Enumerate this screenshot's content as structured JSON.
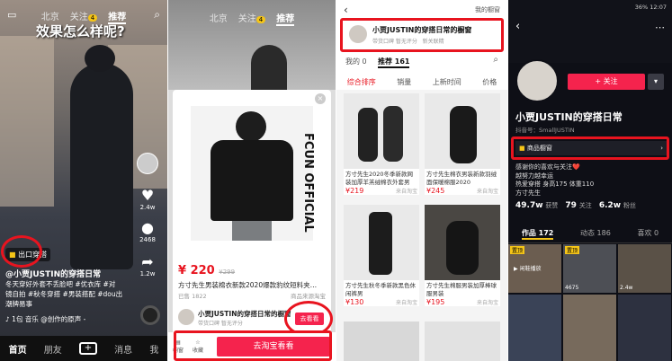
{
  "p1": {
    "nav": [
      "北京",
      "关注",
      "推荐"
    ],
    "nav_badge": "4",
    "overlay_caption": "效果怎么样呢?",
    "side_counts": {
      "like": "2.4w",
      "comment": "2468",
      "share": "1.2w"
    },
    "store_tag": "出口穿搭",
    "author": "@小贾JUSTIN的穿搭日常",
    "desc_line1": "冬天穿好外套不丢脸吧 #优衣库 #对",
    "desc_line2": "镜自拍 #秋冬穿搭 #男装搭配 #dou出",
    "desc_line3": "潮牌易事",
    "music": "♪ 1包 音乐 @创作的原声 - ",
    "bottom_nav": [
      "首页",
      "朋友",
      "+",
      "消息",
      "我"
    ]
  },
  "p2": {
    "nav": [
      "北京",
      "关注",
      "推荐"
    ],
    "nav_badge": "4",
    "price": "¥ 220",
    "orig_price": "¥299",
    "title": "方寸先生男装棉衣新款2020爆款豹纹短料夹…",
    "sold": "已售 1822",
    "source": "商品来源淘宝",
    "shop_name": "小贾JUSTIN的穿搭日常的橱窗",
    "shop_sub": "带货口碑  暂无评分",
    "goto_btn": "去看看",
    "bar_icons": [
      "橱窗",
      "收藏"
    ],
    "bar_btn": "去淘宝看看",
    "brand_text": "FCUN OFFICIAL"
  },
  "p3": {
    "header_right": "我的橱窗",
    "shop_name": "小贾JUSTIN的穿搭日常的橱窗",
    "shop_sub1": "带货口碑  暂无评分",
    "shop_sub2": "新关联精",
    "tab_mine": "我的 0",
    "tab_rec": "推荐 161",
    "sort_tabs": [
      "综合排序",
      "销量",
      "上新时间",
      "价格"
    ],
    "products": [
      {
        "title": "方寸先生2020冬季新款网装加厚羊羔绒棉衣外套男",
        "price": "¥219",
        "src": "来自淘宝"
      },
      {
        "title": "方寸先生棉衣男装新款羽绒面保暖棉服2020",
        "price": "¥245",
        "src": "来自淘宝"
      },
      {
        "title": "方寸先生秋冬季新款黑色休闲裤男",
        "price": "¥130",
        "src": "来自淘宝"
      },
      {
        "title": "方寸先生棉服男装加厚棒球服男装",
        "price": "¥195",
        "src": "来自淘宝"
      }
    ]
  },
  "p4": {
    "status_right": "36%  12:07",
    "follow_btn": "+ 关注",
    "name": "小贾JUSTIN的穿搭日常",
    "douyin_id": "抖音号：SmallJUSTIN",
    "window_label": "商品橱窗",
    "bio1": "感谢你的喜欢与关注❤️",
    "bio2": "越努力越幸运",
    "bio3": "热爱穿搭 身高175 体重110",
    "bio4": "方寸先生",
    "stats": [
      {
        "n": "49.7w",
        "l": "获赞"
      },
      {
        "n": "79",
        "l": "关注"
      },
      {
        "n": "6.2w",
        "l": "粉丝"
      }
    ],
    "tabs": [
      "作品 172",
      "动态 186",
      "喜欢 0"
    ],
    "cell_tags": [
      "置顶",
      "置顶"
    ],
    "cell_play": "▶ 闲鞋播放",
    "cell_counts": [
      "4675",
      "2.4w"
    ]
  },
  "colors": {
    "accent": "#e8141f",
    "douyin_red": "#f5234d",
    "price_red": "#e8141f"
  }
}
